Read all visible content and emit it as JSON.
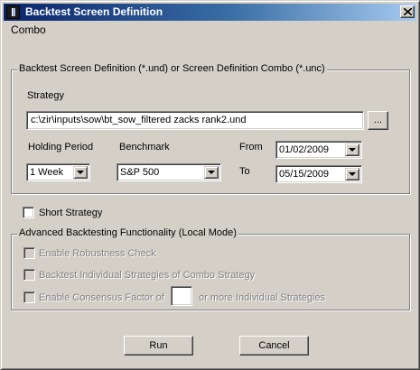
{
  "window": {
    "title": "Backtest Screen Definition",
    "close_glyph": "×",
    "icon": "app-icon"
  },
  "menu": {
    "combo": "Combo"
  },
  "definition_group": {
    "title": "Backtest Screen Definition (*.und) or Screen Definition Combo (*.unc)",
    "strategy_label": "Strategy",
    "strategy_path": "c:\\zir\\inputs\\sow\\bt_sow_filtered zacks rank2.und",
    "browse_label": "...",
    "holding_period_label": "Holding Period",
    "holding_period_value": "1 Week",
    "benchmark_label": "Benchmark",
    "benchmark_value": "S&P 500",
    "from_label": "From",
    "from_value": "01/02/2009",
    "to_label": "To",
    "to_value": "05/15/2009"
  },
  "short_strategy": {
    "label": "Short Strategy",
    "checked": false
  },
  "advanced_group": {
    "title": "Advanced Backtesting Functionality (Local Mode)",
    "robustness_label": "Enable Robustness Check",
    "individual_label": "Backtest Individual Strategies of Combo Strategy",
    "consensus_label": "Enable Consensus Factor of",
    "consensus_value": "",
    "consensus_suffix": "or more Individual Strategies"
  },
  "buttons": {
    "run": "Run",
    "cancel": "Cancel"
  },
  "colors": {
    "title_start": "#0a246a",
    "title_end": "#a6caf0",
    "face": "#d4d0c8",
    "disabled_text": "#808080"
  }
}
